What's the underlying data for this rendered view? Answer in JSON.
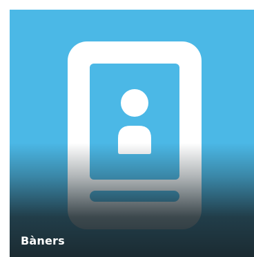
{
  "tile": {
    "label": "Bàners",
    "icon": "id-card-portrait-icon",
    "background_color": "#4bb8e6",
    "icon_color": "#ffffff"
  }
}
